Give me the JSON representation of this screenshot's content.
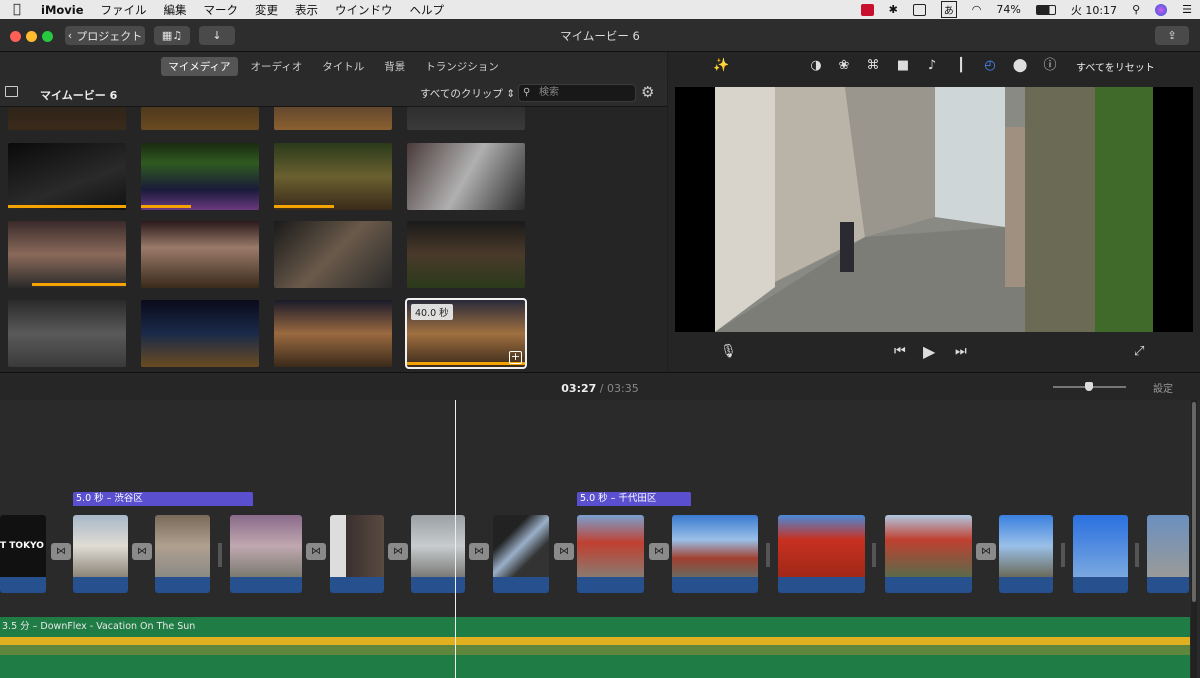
{
  "menubar": {
    "items": [
      "iMovie",
      "ファイル",
      "編集",
      "マーク",
      "変更",
      "表示",
      "ウインドウ",
      "ヘルプ"
    ],
    "battery": "74%",
    "ime": "あ",
    "clock": "火 10:17"
  },
  "toolbar": {
    "back_label": "プロジェクト",
    "title": "マイムービー 6"
  },
  "tabs": [
    "マイメディア",
    "オーディオ",
    "タイトル",
    "背景",
    "トランジション"
  ],
  "library": {
    "title": "マイムービー 6",
    "filter": "すべてのクリップ",
    "search_placeholder": "検索",
    "selected_badge": "40.0 秒"
  },
  "adjust": {
    "reset_label": "すべてをリセット"
  },
  "timeline": {
    "current": "03:27",
    "separator": "/",
    "total": "03:35",
    "settings_label": "設定",
    "labels": [
      "5.0 秒 – 渋谷区",
      "5.0 秒 – 千代田区"
    ],
    "music_label": "3.5 分 – DownFlex - Vacation On The Sun",
    "first_clip_text": "T TOKYO T"
  },
  "colors": {
    "accent": "#5a4fcf",
    "audio": "#27508f",
    "music": "#1f7c44",
    "clip_bar": "#f5a300"
  }
}
